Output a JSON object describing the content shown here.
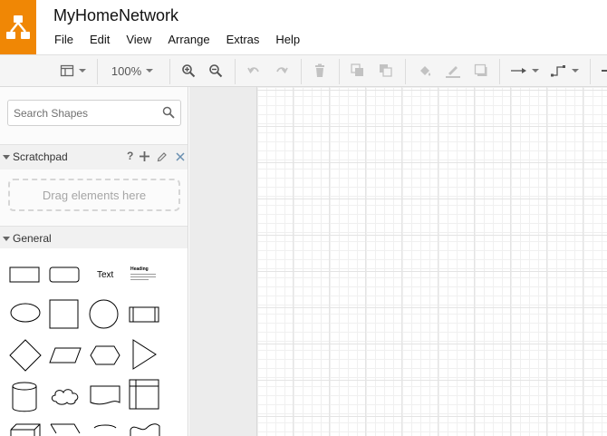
{
  "app": {
    "title": "MyHomeNetwork",
    "brand_color": "#f08705",
    "logo_icon": "drawio-logo-icon"
  },
  "menu": [
    "File",
    "Edit",
    "View",
    "Arrange",
    "Extras",
    "Help"
  ],
  "toolbar": {
    "zoom": "100%",
    "icons": [
      "format-panel-icon",
      "zoom-in-icon",
      "zoom-out-icon",
      "undo-icon",
      "redo-icon",
      "delete-icon",
      "to-front-icon",
      "to-back-icon",
      "fill-color-icon",
      "line-color-icon",
      "shadow-icon",
      "connection-arrow-icon",
      "waypoints-icon"
    ]
  },
  "sidebar": {
    "search": {
      "placeholder": "Search Shapes"
    },
    "scratchpad": {
      "title": "Scratchpad",
      "help_label": "?",
      "drop_hint": "Drag elements here"
    },
    "general": {
      "title": "General",
      "text_shape_label": "Text",
      "heading_shape_label": "Heading",
      "shapes": [
        "rectangle",
        "rounded-rectangle",
        "text",
        "textbox",
        "ellipse",
        "square",
        "circle",
        "process",
        "diamond",
        "parallelogram",
        "hexagon",
        "triangle",
        "cylinder",
        "cloud",
        "document",
        "internal-storage"
      ]
    }
  }
}
